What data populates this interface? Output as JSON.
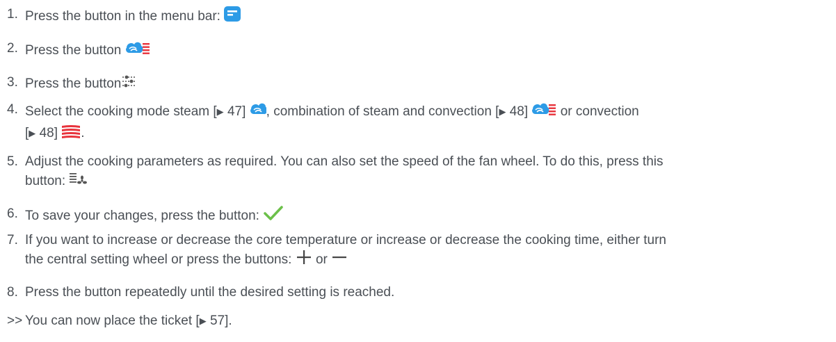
{
  "steps": [
    {
      "num": "1.",
      "text": "Press the button in the menu bar:"
    },
    {
      "num": "2.",
      "text": "Press the button"
    },
    {
      "num": "3.",
      "text": "Press the button"
    },
    {
      "num": "4.",
      "a": "Select the cooking mode steam [",
      "ref1": "47]",
      "b": ", combination of steam and convection [",
      "ref2": "48]",
      "c": " or convection",
      "d": "[",
      "ref3": "48]",
      "e": "."
    },
    {
      "num": "5.",
      "a": "Adjust the cooking parameters as required. You can also set the speed of the fan wheel. To do this, press this",
      "b": "button:"
    },
    {
      "num": "6.",
      "text": "To save your changes, press the button:"
    },
    {
      "num": "7.",
      "a": "If you want to increase or decrease the core temperature or increase or decrease the cooking time, either turn",
      "b": "the central setting wheel or press the buttons:",
      "or": "or"
    },
    {
      "num": "8.",
      "text": "Press the button repeatedly until the desired setting is reached."
    }
  ],
  "result": {
    "marker": ">>",
    "a": "You can now place the ticket [",
    "ref": "57]",
    "b": "."
  },
  "ref_arrow": "▶",
  "icons": {
    "menu": "menu-bar-button-icon",
    "combi": "steam-convection-icon",
    "settings": "settings-sliders-icon",
    "steam": "steam-icon",
    "convection": "convection-icon",
    "fan": "fan-speed-icon",
    "check": "checkmark-icon",
    "plus": "plus-icon",
    "minus": "minus-icon"
  },
  "colors": {
    "text": "#4a4f55",
    "blue": "#2d9be6",
    "red": "#e8333c",
    "green": "#6cc04a"
  }
}
